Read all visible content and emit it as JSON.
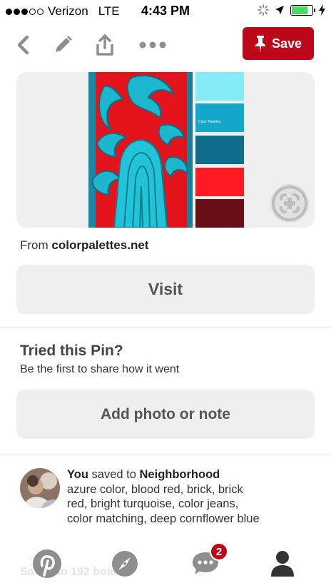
{
  "status_bar": {
    "carrier": "Verizon",
    "network": "LTE",
    "time": "4:43 PM",
    "signal_bars_filled": 3,
    "signal_bars_total": 5,
    "battery_level": 0.8
  },
  "toolbar": {
    "save_label": "Save",
    "icons": [
      "back-icon",
      "edit-icon",
      "share-icon",
      "more-icon",
      "pin-icon"
    ]
  },
  "pin": {
    "swatch_caption": "Color Palettes",
    "swatches": [
      "#85ecf7",
      "#14a7c9",
      "#0f6d8c",
      "#ff1a24",
      "#6a0f18"
    ],
    "source_prefix": "From",
    "source_domain": "colorpalettes.net",
    "visit_label": "Visit"
  },
  "tried": {
    "title": "Tried this Pin?",
    "subtitle": "Be the first to share how it went",
    "add_label": "Add photo or note"
  },
  "activity": {
    "user": "You",
    "action": "saved to",
    "board": "Neighborhood",
    "description": "azure color, blood red, brick, brick red, bright turquoise, color jeans, color matching, deep cornflower blue"
  },
  "behind_text": "Saved to 192 boards",
  "tabbar": {
    "notification_count": "2",
    "icons": [
      "pinterest-logo-icon",
      "explore-compass-icon",
      "messages-icon",
      "profile-icon"
    ]
  },
  "colors": {
    "brand_red": "#bd081c",
    "button_gray": "#efefef",
    "icon_gray": "#8e8e8e",
    "battery_green": "#4cd964"
  }
}
